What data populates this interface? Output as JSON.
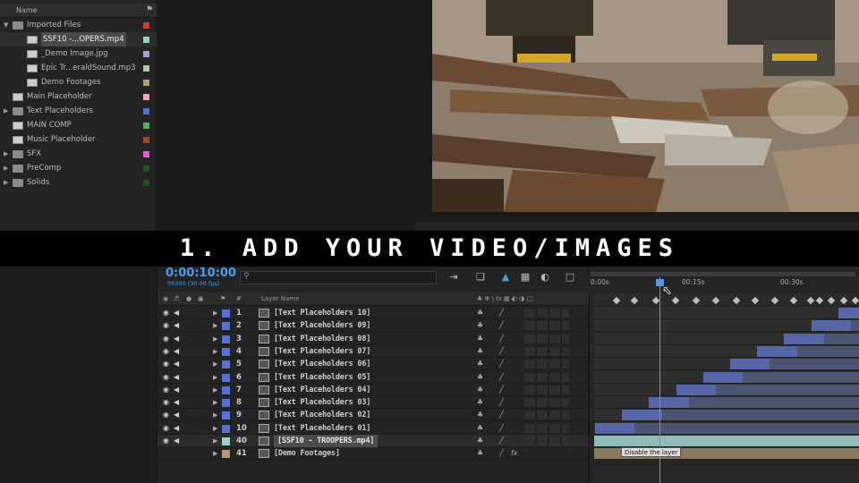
{
  "project": {
    "name_header": "Name",
    "items": [
      {
        "label": "Imported Files",
        "type": "folder",
        "open": true,
        "indent": 0,
        "color": "#c83a3a"
      },
      {
        "label": "SSF10 -...OPERS.mp4",
        "type": "video",
        "indent": 1,
        "color": "#9ccdc6",
        "selected": true
      },
      {
        "label": "_Demo Image.jpg",
        "type": "image",
        "indent": 1,
        "color": "#a7a0d0"
      },
      {
        "label": "Epic Tr...eraldSound.mp3",
        "type": "audio",
        "indent": 1,
        "color": "#a9c7a0"
      },
      {
        "label": "Demo Footages",
        "type": "comp",
        "indent": 1,
        "color": "#b49a78"
      },
      {
        "label": "Main Placeholder",
        "type": "comp",
        "indent": 0,
        "color": "#e8a8c0"
      },
      {
        "label": "Text Placeholders",
        "type": "folder",
        "indent": 0,
        "color": "#5b6fd1"
      },
      {
        "label": "MAIN COMP",
        "type": "comp",
        "indent": 0,
        "color": "#4fb04f"
      },
      {
        "label": "Music Placeholder",
        "type": "comp",
        "indent": 0,
        "color": "#9b4a2a"
      },
      {
        "label": "SFX",
        "type": "folder",
        "indent": 0,
        "color": "#e060c8"
      },
      {
        "label": "PreComp",
        "type": "folder",
        "indent": 0,
        "color": "#1f4f2a"
      },
      {
        "label": "Solids",
        "type": "folder",
        "indent": 0,
        "color": "#1f4f2a"
      }
    ]
  },
  "banner": {
    "text": "1. ADD YOUR VIDEO/IMAGES"
  },
  "timeline": {
    "timecode": "0:00:10:00",
    "fps": "00300 (30.00 fps)",
    "layer_name_header": "Layer Name",
    "ruler_ticks": [
      "0:00s",
      "00:15s",
      "00:30s"
    ],
    "tooltip": "Disable the layer",
    "layers": [
      {
        "num": "1",
        "name": "[Text Placeholders 10]",
        "color": "#5b6fd1"
      },
      {
        "num": "2",
        "name": "[Text Placeholders 09]",
        "color": "#5b6fd1"
      },
      {
        "num": "3",
        "name": "[Text Placeholders 08]",
        "color": "#5b6fd1"
      },
      {
        "num": "4",
        "name": "[Text Placeholders 07]",
        "color": "#5b6fd1"
      },
      {
        "num": "5",
        "name": "[Text Placeholders 06]",
        "color": "#5b6fd1"
      },
      {
        "num": "6",
        "name": "[Text Placeholders 05]",
        "color": "#5b6fd1"
      },
      {
        "num": "7",
        "name": "[Text Placeholders 04]",
        "color": "#5b6fd1"
      },
      {
        "num": "8",
        "name": "[Text Placeholders 03]",
        "color": "#5b6fd1"
      },
      {
        "num": "9",
        "name": "[Text Placeholders 02]",
        "color": "#5b6fd1"
      },
      {
        "num": "10",
        "name": "[Text Placeholders 01]",
        "color": "#5b6fd1"
      },
      {
        "num": "40",
        "name": "[SSF10 - TROOPERS.mp4]",
        "color": "#9ccdc6",
        "selected": true
      },
      {
        "num": "41",
        "name": "[Demo Footages]",
        "color": "#b49a78"
      }
    ]
  }
}
